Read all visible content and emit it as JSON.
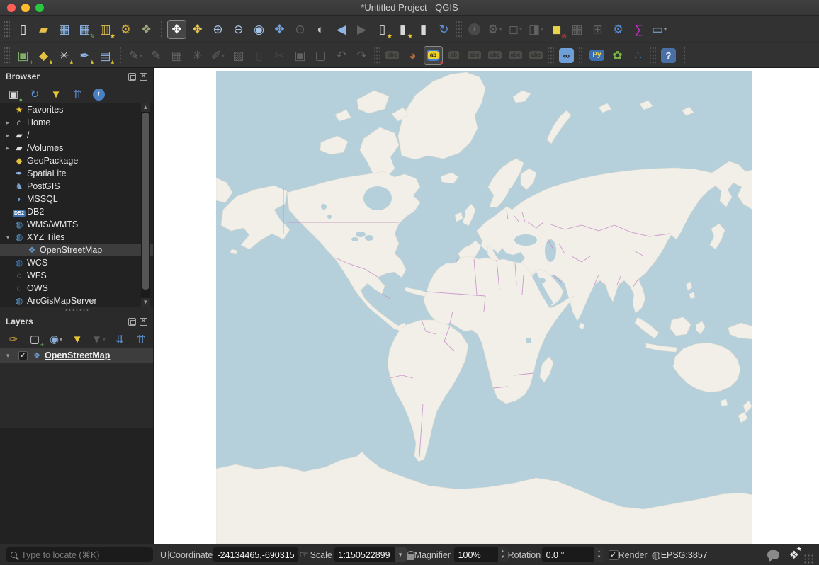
{
  "window": {
    "title": "*Untitled Project - QGIS",
    "traffic_lights": {
      "close": "#ff5f57",
      "minimize": "#febc2e",
      "zoom": "#28c840"
    }
  },
  "icons_note": "glyphs are unicode stand-ins for QGIS toolbar icons",
  "toolbar1": {
    "items": [
      {
        "type": "handle"
      },
      {
        "name": "new-project",
        "glyph": "▯",
        "color": "#f2f2f2"
      },
      {
        "name": "open-project",
        "glyph": "▰",
        "color": "#e7c04a"
      },
      {
        "name": "save-project",
        "glyph": "▦",
        "color": "#8fb6e6"
      },
      {
        "name": "save-project-as",
        "glyph": "▦",
        "color": "#8fb6e6",
        "badge": "✎",
        "badgeColor": "#69b556"
      },
      {
        "name": "new-print-layout",
        "glyph": "▥",
        "color": "#dfc04e",
        "badge": "★",
        "badgeColor": "#e8c832"
      },
      {
        "name": "show-layout-manager",
        "glyph": "⚙",
        "color": "#d9b23c"
      },
      {
        "name": "style-manager",
        "glyph": "❖",
        "color": "#9aa579"
      },
      {
        "type": "sep"
      },
      {
        "name": "pan-map",
        "glyph": "✥",
        "color": "#ffffff",
        "active": true
      },
      {
        "name": "pan-to-selection",
        "glyph": "✥",
        "color": "#e4c44c"
      },
      {
        "name": "zoom-in",
        "glyph": "⊕",
        "color": "#a8c4e8"
      },
      {
        "name": "zoom-out",
        "glyph": "⊖",
        "color": "#a8c4e8"
      },
      {
        "name": "zoom-native-resolution",
        "glyph": "◉",
        "color": "#a8c4e8"
      },
      {
        "name": "zoom-full",
        "glyph": "✥",
        "color": "#74a2dc"
      },
      {
        "name": "zoom-to-selection",
        "glyph": "⊙",
        "disabled": true
      },
      {
        "name": "zoom-to-layer",
        "glyph": "◐",
        "color": "#c8c8c8"
      },
      {
        "name": "zoom-last",
        "glyph": "◀",
        "color": "#8fb6e6"
      },
      {
        "name": "zoom-next",
        "glyph": "▶",
        "disabled": true
      },
      {
        "name": "new-spatial-bookmark",
        "glyph": "▯",
        "color": "#d8d8d8",
        "badge": "★",
        "badgeColor": "#e8c832"
      },
      {
        "name": "show-spatial-bookmarks",
        "glyph": "▮",
        "color": "#d8d8d8",
        "badge": "★",
        "badgeColor": "#e8c832"
      },
      {
        "name": "spatial-bookmark-manager",
        "glyph": "▮",
        "color": "#d8d8d8"
      },
      {
        "name": "refresh-map",
        "glyph": "↻",
        "color": "#5e93d8"
      },
      {
        "type": "sep"
      },
      {
        "name": "identify-features",
        "kind": "circled",
        "glyph": "i",
        "disabled": true
      },
      {
        "name": "run-feature-action",
        "glyph": "⚙",
        "disabled": true,
        "dropdown": true
      },
      {
        "name": "select-features",
        "glyph": "◻",
        "disabled": true,
        "dropdown": true
      },
      {
        "name": "select-features-by-value",
        "glyph": "◨",
        "disabled": true,
        "dropdown": true
      },
      {
        "name": "deselect-features-all-layers",
        "glyph": "◼",
        "color": "#e8d44a",
        "badge": "⊘",
        "badgeColor": "#d04040"
      },
      {
        "name": "open-attribute-table",
        "glyph": "▦",
        "disabled": true
      },
      {
        "name": "field-calculator",
        "glyph": "⊞",
        "disabled": true
      },
      {
        "name": "processing-toolbox",
        "glyph": "⚙",
        "color": "#5b8fd4"
      },
      {
        "name": "statistical-summary",
        "glyph": "∑",
        "color": "#c62fc6"
      },
      {
        "name": "measure-line",
        "glyph": "▭",
        "color": "#7fb0e0",
        "dropdown": true
      }
    ]
  },
  "toolbar2": {
    "items": [
      {
        "type": "handle"
      },
      {
        "name": "open-data-source-manager",
        "glyph": "▣",
        "color": "#7fb06a",
        "badge": "+",
        "badgeColor": "#5fae4f"
      },
      {
        "name": "new-geopackage-layer",
        "glyph": "◆",
        "color": "#e2c040",
        "badge": "★",
        "badgeColor": "#e8c832"
      },
      {
        "name": "new-shapefile-layer",
        "glyph": "✳",
        "color": "#d8d8d8",
        "badge": "★",
        "badgeColor": "#e8c832"
      },
      {
        "name": "new-spatialite-layer",
        "glyph": "✒",
        "color": "#8fb6e6",
        "badge": "★",
        "badgeColor": "#e8c832"
      },
      {
        "name": "new-virtual-layer",
        "glyph": "▤",
        "color": "#8fb6e6",
        "badge": "★",
        "badgeColor": "#e8c832"
      },
      {
        "type": "sep"
      },
      {
        "name": "current-edits",
        "glyph": "✎",
        "disabled": true,
        "dropdown": true
      },
      {
        "name": "toggle-editing",
        "glyph": "✎",
        "disabled": true
      },
      {
        "name": "save-layer-edits",
        "glyph": "▦",
        "disabled": true
      },
      {
        "name": "add-feature",
        "glyph": "✳",
        "disabled": true
      },
      {
        "name": "vertex-tool",
        "glyph": "✐",
        "disabled": true,
        "dropdown": true
      },
      {
        "name": "modify-attributes",
        "glyph": "▨",
        "disabled": true
      },
      {
        "name": "delete-selected",
        "glyph": "▯",
        "disabled": true,
        "tint": "#b05858"
      },
      {
        "name": "cut-features",
        "glyph": "✂",
        "disabled": true,
        "tint": "#b05858"
      },
      {
        "name": "copy-features",
        "glyph": "▣",
        "disabled": true
      },
      {
        "name": "paste-features",
        "glyph": "▢",
        "disabled": true
      },
      {
        "name": "undo",
        "glyph": "↶",
        "disabled": true
      },
      {
        "name": "redo",
        "glyph": "↷",
        "disabled": true
      },
      {
        "type": "sep"
      },
      {
        "name": "layer-labeling-options",
        "kind": "chip",
        "text": "abc",
        "disabled": true
      },
      {
        "name": "layer-diagram-options",
        "glyph": "◕",
        "color": "#b06a3a"
      },
      {
        "name": "highlight-pinned-labels",
        "kind": "chip",
        "text": "ab",
        "active": true,
        "badge": "●",
        "badgeColor": "#d04040"
      },
      {
        "name": "pin-unpin-labels",
        "kind": "chip",
        "text": "ab",
        "disabled": true
      },
      {
        "name": "show-hide-labels",
        "kind": "chip",
        "text": "abc",
        "disabled": true
      },
      {
        "name": "move-label",
        "kind": "chip",
        "text": "abc",
        "disabled": true
      },
      {
        "name": "rotate-label",
        "kind": "chip",
        "text": "abc",
        "disabled": true
      },
      {
        "name": "change-label-properties",
        "kind": "chip",
        "text": "abc",
        "disabled": true
      },
      {
        "type": "sep"
      },
      {
        "name": "osm-place-search",
        "kind": "tile",
        "glyph": "∞",
        "color": "#16181c",
        "bg": "#6f9fd8"
      },
      {
        "type": "sep"
      },
      {
        "name": "python-console",
        "kind": "pychip",
        "text": "Py"
      },
      {
        "name": "plugin-leaf",
        "glyph": "✿",
        "color": "#7ab648"
      },
      {
        "name": "plugin-nodes",
        "glyph": "∴",
        "color": "#2f7fc0"
      },
      {
        "type": "sep"
      },
      {
        "name": "help-contents",
        "kind": "tile",
        "glyph": "?",
        "color": "#eaf0fa",
        "bg": "#4a6fa5"
      },
      {
        "type": "handle"
      }
    ]
  },
  "browser_panel": {
    "title": "Browser",
    "toolbar": [
      {
        "name": "add-selected-layers",
        "glyph": "▣",
        "color": "#d8d8d8",
        "badge": "●",
        "badgeColor": "#5fae4f"
      },
      {
        "name": "refresh-browser",
        "glyph": "↻",
        "color": "#5e93d8"
      },
      {
        "name": "filter-browser",
        "glyph": "▼",
        "color": "#e8c832"
      },
      {
        "name": "collapse-all-browser",
        "glyph": "⇈",
        "color": "#5b8fd4"
      },
      {
        "name": "properties-widget",
        "kind": "circled",
        "glyph": "i",
        "color": "#ffffff",
        "bg": "#4a7fc0"
      }
    ],
    "items": [
      {
        "label": "Favorites",
        "icon": "star",
        "glyph": "★",
        "color": "#e8c832",
        "depth": 1
      },
      {
        "label": "Home",
        "icon": "home-folder",
        "glyph": "⌂",
        "color": "#e8e8e8",
        "depth": 1,
        "arrow": "collapsed"
      },
      {
        "label": "/",
        "icon": "folder",
        "glyph": "▰",
        "color": "#e0e0e0",
        "depth": 1,
        "arrow": "collapsed"
      },
      {
        "label": "/Volumes",
        "icon": "folder",
        "glyph": "▰",
        "color": "#e0e0e0",
        "depth": 1,
        "arrow": "collapsed"
      },
      {
        "label": "GeoPackage",
        "icon": "geopackage",
        "glyph": "◆",
        "color": "#e2c040",
        "depth": 1
      },
      {
        "label": "SpatiaLite",
        "icon": "spatialite",
        "glyph": "✒",
        "color": "#8fb6e6",
        "depth": 1
      },
      {
        "label": "PostGIS",
        "icon": "postgis",
        "glyph": "♞",
        "color": "#7fa8d8",
        "depth": 1
      },
      {
        "label": "MSSQL",
        "icon": "mssql",
        "glyph": "◗",
        "color": "#6898c8",
        "depth": 1
      },
      {
        "label": "DB2",
        "icon": "db2",
        "kind": "dbchip",
        "text": "DB2",
        "depth": 1
      },
      {
        "label": "WMS/WMTS",
        "icon": "wms",
        "glyph": "◍",
        "color": "#5b9fd4",
        "depth": 1
      },
      {
        "label": "XYZ Tiles",
        "icon": "xyz-tiles",
        "glyph": "◍",
        "color": "#5b9fd4",
        "depth": 1,
        "arrow": "expanded"
      },
      {
        "label": "OpenStreetMap",
        "icon": "osm-tiles",
        "glyph": "❖",
        "color": "#6898c8",
        "depth": 2,
        "selected": true
      },
      {
        "label": "WCS",
        "icon": "wcs",
        "glyph": "◍",
        "color": "#4a7fc0",
        "depth": 1
      },
      {
        "label": "WFS",
        "icon": "wfs",
        "glyph": "◌",
        "color": "#88a8c8",
        "depth": 1
      },
      {
        "label": "OWS",
        "icon": "ows",
        "glyph": "◌",
        "color": "#88a8c8",
        "depth": 1
      },
      {
        "label": "ArcGisMapServer",
        "icon": "arcgis",
        "glyph": "◍",
        "color": "#5b9fd4",
        "depth": 1,
        "clipped": true
      }
    ]
  },
  "layers_panel": {
    "title": "Layers",
    "toolbar": [
      {
        "name": "open-layer-styling-panel",
        "glyph": "✑",
        "color": "#d4a43a"
      },
      {
        "name": "add-group",
        "glyph": "▢",
        "color": "#d8d8d8",
        "badge": "+",
        "badgeColor": "#5fae4f"
      },
      {
        "name": "manage-map-themes",
        "glyph": "◉",
        "color": "#8fb0d8",
        "dropdown": true
      },
      {
        "name": "filter-legend",
        "glyph": "▼",
        "color": "#e8c832"
      },
      {
        "name": "filter-by-expression",
        "glyph": "▼",
        "disabled": true,
        "dropdown": true
      },
      {
        "name": "expand-all-layers",
        "glyph": "⇊",
        "color": "#5b8fd4"
      },
      {
        "name": "collapse-all-layers",
        "glyph": "⇈",
        "color": "#5b8fd4"
      }
    ],
    "layers": [
      {
        "label": "OpenStreetMap",
        "checked": true,
        "expanded": true,
        "icon": "osm-tiles",
        "glyph": "❖",
        "color": "#6898c8",
        "selected": true
      }
    ]
  },
  "statusbar": {
    "locator_placeholder": "Type to locate (⌘K)",
    "message_clipped": "U",
    "coordinate_label": "Coordinate",
    "coordinate_value": "-24134465,-690315",
    "scale_label": "Scale",
    "scale_value": "1:150522899",
    "magnifier_label": "Magnifier",
    "magnifier_value": "100%",
    "rotation_label": "Rotation",
    "rotation_value": "0.0 °",
    "render_label": "Render",
    "crs": "EPSG:3857",
    "render_checked": true
  },
  "map": {
    "layer": "OpenStreetMap world view",
    "colors": {
      "sea": "#b5d0da",
      "land": "#f2efe8",
      "border": "#c48cc8",
      "canvas_margin": "#ffffff"
    }
  }
}
